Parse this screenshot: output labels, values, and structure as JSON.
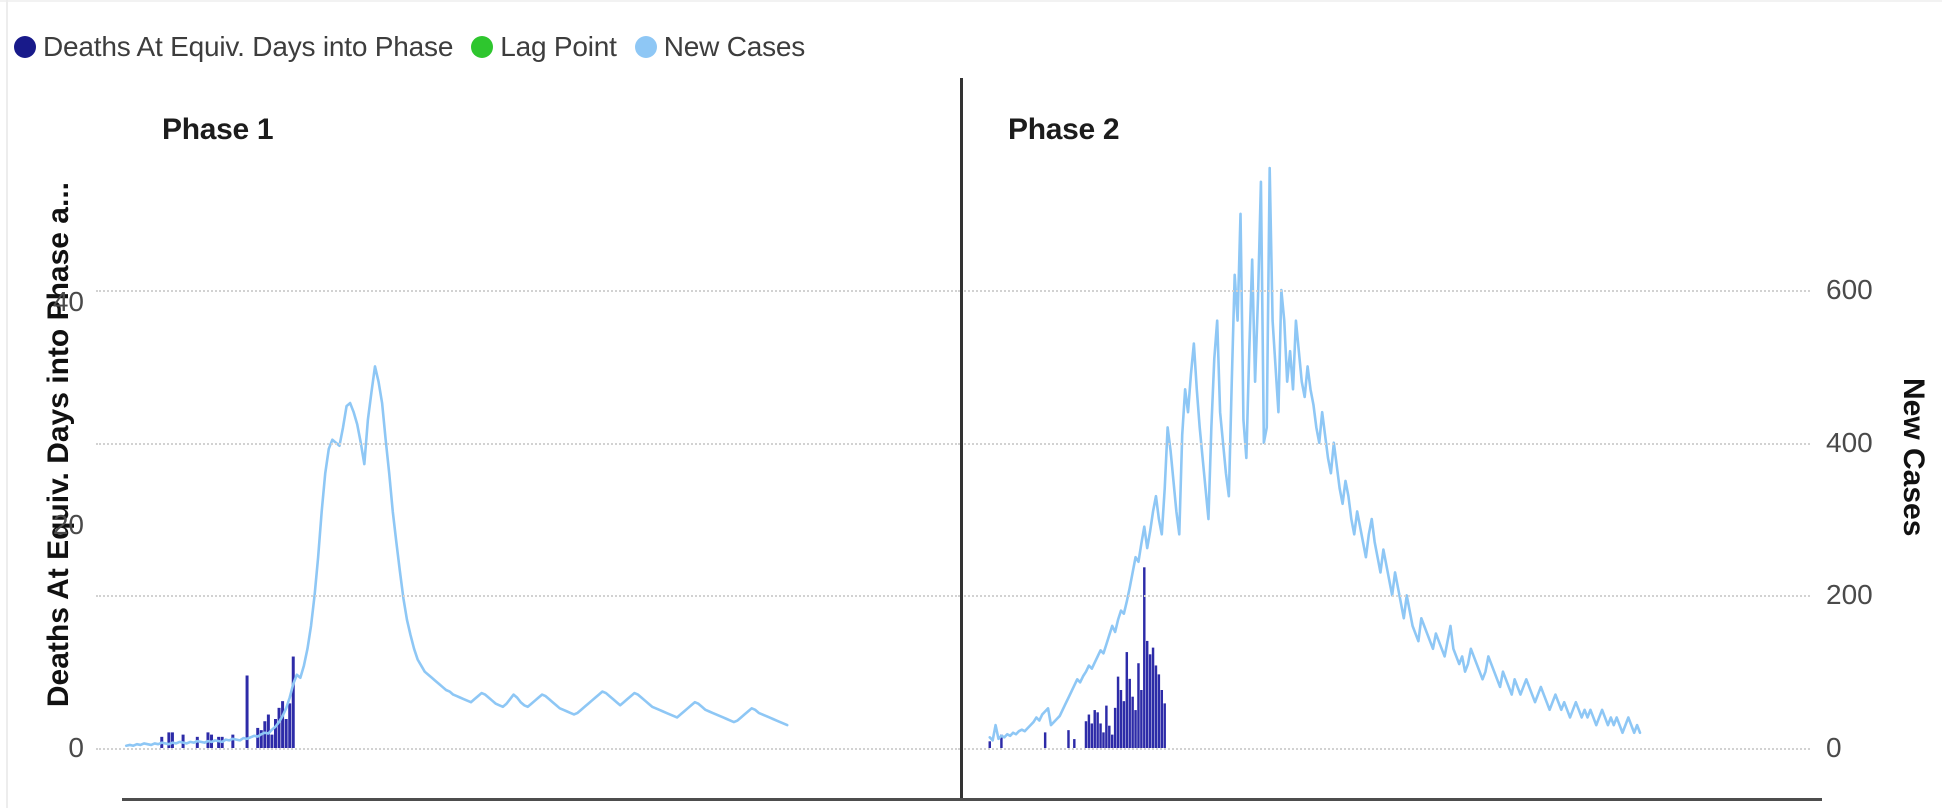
{
  "legend": {
    "items": [
      {
        "label": "Deaths At Equiv. Days into Phase",
        "color": "#181a8a",
        "icon": "legend-dot-icon"
      },
      {
        "label": "Lag Point",
        "color": "#2ec62e",
        "icon": "legend-dot-icon"
      },
      {
        "label": "New Cases",
        "color": "#8ec7f5",
        "icon": "legend-dot-icon"
      }
    ]
  },
  "axes": {
    "left_title": "Deaths At Equiv. Days into Phase a...",
    "right_title": "New Cases",
    "left_ticks": [
      "40",
      "20",
      "0"
    ],
    "right_ticks": [
      "600",
      "400",
      "200",
      "0"
    ]
  },
  "panels": [
    {
      "title": "Phase 1"
    },
    {
      "title": "Phase 2"
    }
  ],
  "chart_data": {
    "type": "line",
    "title": "",
    "subtitle": "",
    "xlabel": "",
    "ylabel_left": "Deaths At Equiv. Days into Phase a...",
    "ylabel_right": "New Cases",
    "grid": true,
    "legend_position": "top-left",
    "facets": [
      "Phase 1",
      "Phase 2"
    ],
    "left_axis": {
      "ticks": [
        0,
        20,
        40
      ],
      "ylim": [
        0,
        52
      ],
      "label": "Deaths At Equiv. Days into Phase a..."
    },
    "right_axis": {
      "ticks": [
        0,
        200,
        400,
        600
      ],
      "ylim": [
        0,
        760
      ],
      "label": "New Cases"
    },
    "series": [
      {
        "name": "New Cases",
        "facet": "Phase 1",
        "type": "line",
        "color": "#8ec7f5",
        "axis": "right",
        "values": [
          3,
          4,
          3,
          5,
          4,
          6,
          5,
          4,
          6,
          5,
          7,
          6,
          5,
          7,
          6,
          8,
          7,
          6,
          8,
          7,
          9,
          8,
          7,
          9,
          8,
          10,
          9,
          8,
          11,
          10,
          12,
          11,
          10,
          13,
          12,
          14,
          16,
          15,
          18,
          20,
          19,
          24,
          28,
          34,
          42,
          52,
          66,
          84,
          96,
          92,
          108,
          130,
          160,
          200,
          250,
          310,
          360,
          392,
          404,
          400,
          396,
          420,
          448,
          452,
          440,
          424,
          400,
          372,
          430,
          466,
          500,
          480,
          452,
          404,
          360,
          310,
          270,
          232,
          196,
          168,
          148,
          130,
          116,
          108,
          100,
          96,
          92,
          88,
          84,
          80,
          76,
          74,
          70,
          68,
          66,
          64,
          62,
          60,
          64,
          68,
          72,
          70,
          66,
          62,
          58,
          56,
          54,
          58,
          64,
          70,
          66,
          60,
          56,
          54,
          58,
          62,
          66,
          70,
          68,
          64,
          60,
          56,
          52,
          50,
          48,
          46,
          44,
          46,
          50,
          54,
          58,
          62,
          66,
          70,
          74,
          72,
          68,
          64,
          60,
          56,
          60,
          64,
          68,
          72,
          70,
          66,
          62,
          58,
          54,
          52,
          50,
          48,
          46,
          44,
          42,
          40,
          44,
          48,
          52,
          56,
          60,
          58,
          54,
          50,
          48,
          46,
          44,
          42,
          40,
          38,
          36,
          34,
          36,
          40,
          44,
          48,
          52,
          50,
          46,
          44,
          42,
          40,
          38,
          36,
          34,
          32,
          30
        ]
      },
      {
        "name": "Deaths At Equiv. Days into Phase",
        "facet": "Phase 1",
        "type": "bar",
        "color": "#2d2ba8",
        "axis": "left",
        "values": [
          0,
          0,
          0,
          0,
          0,
          0,
          0,
          0,
          0,
          0,
          1,
          0,
          1.4,
          1.4,
          0,
          0,
          1.2,
          0,
          0,
          0,
          1.0,
          0,
          0,
          1.4,
          1.2,
          0,
          1.0,
          1.0,
          0,
          0,
          1.2,
          0,
          0,
          0,
          6.5,
          0,
          0,
          1.8,
          1.6,
          2.4,
          3.0,
          1.2,
          2.6,
          3.6,
          4.2,
          2.6,
          4.0,
          8.2,
          0,
          0,
          0,
          0,
          0,
          0,
          0,
          0,
          0,
          0,
          0,
          0,
          0,
          0,
          0,
          0,
          0,
          0,
          0,
          0,
          0,
          0,
          0,
          0,
          0,
          0,
          0,
          0,
          0,
          0,
          0,
          0,
          0,
          0,
          0,
          0,
          0,
          0,
          0,
          0,
          0,
          0,
          0,
          0,
          0,
          0,
          0,
          0,
          0,
          0,
          0,
          0,
          0,
          0,
          0,
          0,
          0,
          0,
          0,
          0,
          0,
          0,
          0,
          0,
          0,
          0,
          0,
          0,
          0,
          0,
          0,
          0,
          0,
          0,
          0,
          0,
          0,
          0,
          0,
          0,
          0,
          0,
          0,
          0,
          0,
          0,
          0,
          0,
          0,
          0,
          0,
          0,
          0,
          0,
          0,
          0,
          0,
          0,
          0,
          0,
          0,
          0,
          0,
          0,
          0,
          0,
          0,
          0,
          0,
          0,
          0,
          0,
          0,
          0,
          0,
          0,
          0,
          0,
          0,
          0,
          0,
          0,
          0,
          0,
          0,
          0,
          0,
          0,
          0,
          0,
          0,
          0,
          0,
          0,
          0,
          0,
          0,
          0,
          0,
          0,
          0,
          0,
          0,
          0,
          0,
          0,
          0,
          0
        ]
      },
      {
        "name": "New Cases",
        "facet": "Phase 2",
        "type": "line",
        "color": "#8ec7f5",
        "axis": "right",
        "values": [
          14,
          10,
          30,
          12,
          16,
          14,
          18,
          16,
          20,
          18,
          22,
          24,
          22,
          26,
          30,
          34,
          40,
          36,
          44,
          48,
          52,
          30,
          34,
          38,
          42,
          50,
          58,
          66,
          74,
          82,
          90,
          86,
          94,
          100,
          108,
          104,
          112,
          120,
          128,
          124,
          136,
          148,
          160,
          152,
          168,
          180,
          176,
          192,
          210,
          230,
          250,
          244,
          268,
          290,
          262,
          284,
          310,
          330,
          300,
          280,
          340,
          420,
          390,
          350,
          310,
          280,
          410,
          470,
          440,
          490,
          530,
          470,
          420,
          380,
          340,
          300,
          420,
          510,
          560,
          440,
          400,
          360,
          330,
          480,
          620,
          560,
          700,
          430,
          380,
          520,
          640,
          480,
          590,
          742,
          400,
          420,
          760,
          560,
          500,
          440,
          600,
          560,
          480,
          520,
          470,
          560,
          520,
          480,
          460,
          500,
          470,
          450,
          420,
          400,
          440,
          410,
          380,
          360,
          400,
          370,
          340,
          320,
          350,
          330,
          300,
          280,
          310,
          290,
          270,
          250,
          280,
          300,
          270,
          250,
          230,
          260,
          240,
          220,
          200,
          230,
          210,
          190,
          170,
          200,
          180,
          160,
          150,
          140,
          170,
          160,
          150,
          140,
          130,
          150,
          140,
          130,
          120,
          140,
          160,
          130,
          120,
          110,
          120,
          100,
          110,
          130,
          120,
          110,
          100,
          90,
          100,
          120,
          110,
          100,
          90,
          80,
          100,
          90,
          80,
          70,
          90,
          80,
          70,
          80,
          90,
          80,
          70,
          60,
          70,
          80,
          70,
          60,
          50,
          60,
          70,
          60,
          50,
          60,
          50,
          40,
          50,
          60,
          50,
          40,
          50,
          40,
          50,
          40,
          30,
          40,
          50,
          40,
          30,
          40,
          30,
          40,
          30,
          20,
          30,
          40,
          30,
          20,
          30,
          20
        ]
      },
      {
        "name": "Deaths At Equiv. Days into Phase",
        "facet": "Phase 2",
        "type": "bar",
        "color": "#2d2ba8",
        "axis": "left",
        "values": [
          0.6,
          0,
          0,
          0,
          1.2,
          0,
          0,
          0,
          0,
          0,
          0,
          0,
          0,
          0,
          0,
          0,
          0,
          0,
          0,
          1.4,
          0,
          0,
          0,
          0,
          0,
          0,
          0,
          1.6,
          0,
          0.8,
          0,
          0,
          0,
          2.4,
          3.0,
          2.2,
          3.4,
          3.2,
          2.2,
          1.4,
          3.8,
          2.0,
          1.2,
          3.6,
          6.4,
          5.2,
          4.2,
          8.6,
          6.2,
          4.6,
          3.4,
          7.6,
          5.2,
          16.2,
          9.6,
          8.4,
          9.0,
          7.4,
          6.6,
          5.2,
          4.0,
          0,
          0,
          0,
          0,
          0,
          0,
          0,
          0,
          0,
          0,
          0,
          0,
          0,
          0,
          0,
          0,
          0,
          0,
          0,
          0,
          0,
          0,
          0,
          0,
          0,
          0,
          0,
          0,
          0,
          0,
          0,
          0,
          0,
          0,
          0,
          0,
          0,
          0,
          0,
          0,
          0,
          0,
          0,
          0,
          0,
          0,
          0,
          0,
          0,
          0,
          0,
          0,
          0,
          0,
          0,
          0,
          0,
          0,
          0,
          0,
          0,
          0,
          0,
          0,
          0,
          0,
          0,
          0,
          0,
          0,
          0,
          0,
          0,
          0,
          0,
          0,
          0,
          0,
          0,
          0,
          0,
          0,
          0,
          0,
          0,
          0,
          0,
          0,
          0,
          0,
          0,
          0,
          0,
          0,
          0,
          0,
          0,
          0,
          0,
          0,
          0,
          0,
          0,
          0,
          0,
          0,
          0,
          0,
          0,
          0,
          0,
          0,
          0,
          0,
          0,
          0,
          0,
          0,
          0,
          0,
          0,
          0,
          0,
          0,
          0,
          0,
          0,
          0,
          0,
          0,
          0,
          0,
          0,
          0,
          0,
          0,
          0,
          0,
          0,
          0,
          0,
          0,
          0,
          0,
          0,
          0,
          0,
          0,
          0,
          0,
          0,
          0,
          0,
          0,
          0,
          0,
          0,
          0,
          0,
          0,
          0,
          0,
          0,
          0,
          0,
          0,
          0,
          0,
          0,
          0,
          0,
          0,
          0,
          0,
          0,
          0,
          0,
          0,
          0,
          0,
          0,
          0,
          0,
          0,
          0,
          0,
          0,
          0
        ]
      }
    ]
  }
}
